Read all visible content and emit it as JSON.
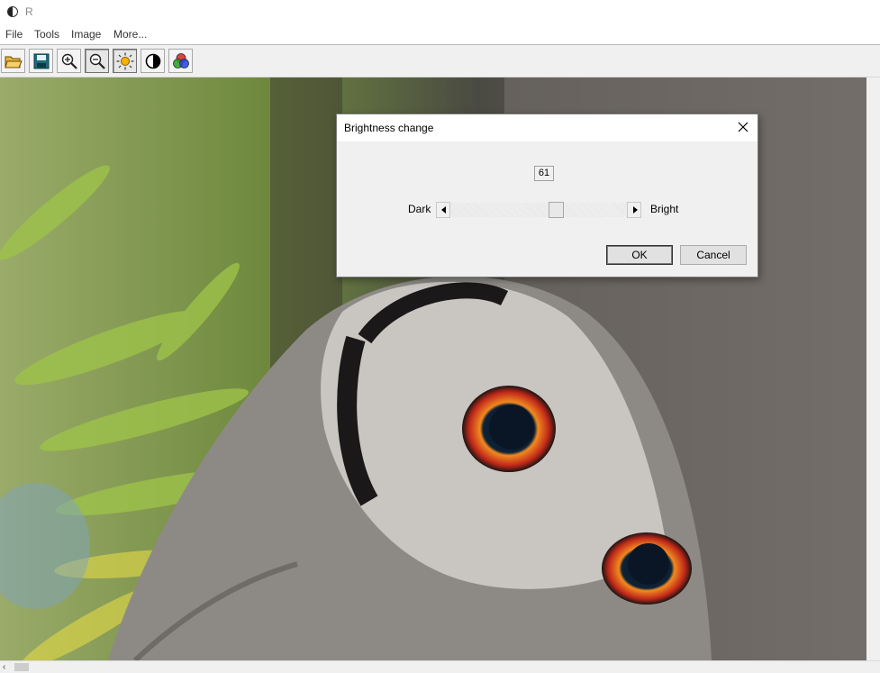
{
  "window": {
    "title": "R"
  },
  "menu": {
    "items": [
      "File",
      "Tools",
      "Image",
      "More..."
    ]
  },
  "toolbar": {
    "buttons": [
      {
        "icon": "open-folder-icon",
        "pressed": false
      },
      {
        "icon": "save-icon",
        "pressed": false
      },
      {
        "icon": "zoom-in-icon",
        "pressed": false
      },
      {
        "icon": "zoom-out-icon",
        "pressed": true
      },
      {
        "icon": "brightness-icon",
        "pressed": true
      },
      {
        "icon": "contrast-icon",
        "pressed": false
      },
      {
        "icon": "color-icon",
        "pressed": false
      }
    ]
  },
  "dialog": {
    "title": "Brightness change",
    "value": "61",
    "dark_label": "Dark",
    "bright_label": "Bright",
    "slider_fraction": 0.61,
    "ok_label": "OK",
    "cancel_label": "Cancel"
  },
  "scrollbar": {
    "left_arrow": "‹"
  }
}
